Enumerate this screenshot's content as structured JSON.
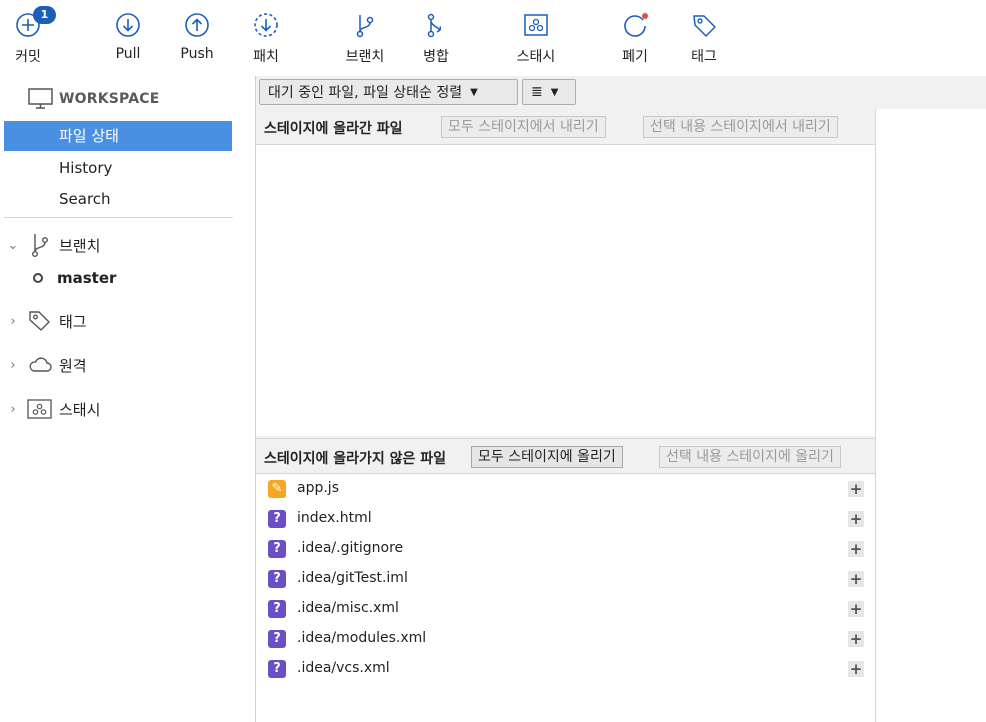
{
  "toolbar": {
    "commit": {
      "label": "커밋",
      "badge": "1"
    },
    "pull": {
      "label": "Pull"
    },
    "push": {
      "label": "Push"
    },
    "patch": {
      "label": "패치"
    },
    "branch": {
      "label": "브랜치"
    },
    "merge": {
      "label": "병합"
    },
    "stash": {
      "label": "스태시"
    },
    "discard": {
      "label": "폐기"
    },
    "tag": {
      "label": "태그"
    }
  },
  "sidebar": {
    "workspace_label": "WORKSPACE",
    "workspace_items": [
      "파일 상태",
      "History",
      "Search"
    ],
    "groups": {
      "branches": {
        "label": "브랜치",
        "items": [
          "master"
        ]
      },
      "tags": {
        "label": "태그"
      },
      "remotes": {
        "label": "원격"
      },
      "stashes": {
        "label": "스태시"
      }
    }
  },
  "filter": {
    "sort_option": "대기 중인 파일, 파일 상태순 정렬",
    "view_option": "≣"
  },
  "staged": {
    "title": "스테이지에 올라간 파일",
    "unstage_all": "모두 스테이지에서 내리기",
    "unstage_selected": "선택 내용 스테이지에서 내리기"
  },
  "unstaged": {
    "title": "스테이지에 올라가지 않은 파일",
    "stage_all": "모두 스테이지에 올리기",
    "stage_selected": "선택 내용 스테이지에 올리기",
    "files": [
      {
        "name": "app.js",
        "status": "modified",
        "icon": "✎"
      },
      {
        "name": "index.html",
        "status": "unknown",
        "icon": "?"
      },
      {
        "name": ".idea/.gitignore",
        "status": "unknown",
        "icon": "?"
      },
      {
        "name": ".idea/gitTest.iml",
        "status": "unknown",
        "icon": "?"
      },
      {
        "name": ".idea/misc.xml",
        "status": "unknown",
        "icon": "?"
      },
      {
        "name": ".idea/modules.xml",
        "status": "unknown",
        "icon": "?"
      },
      {
        "name": ".idea/vcs.xml",
        "status": "unknown",
        "icon": "?"
      }
    ],
    "add_icon": "+"
  },
  "colors": {
    "accent": "#4a90e2",
    "toolbar_icon": "#1b5fb8",
    "badge": "#1b5fb8",
    "unknown_file": "#6a4fc7",
    "modified_file": "#f5a623"
  }
}
